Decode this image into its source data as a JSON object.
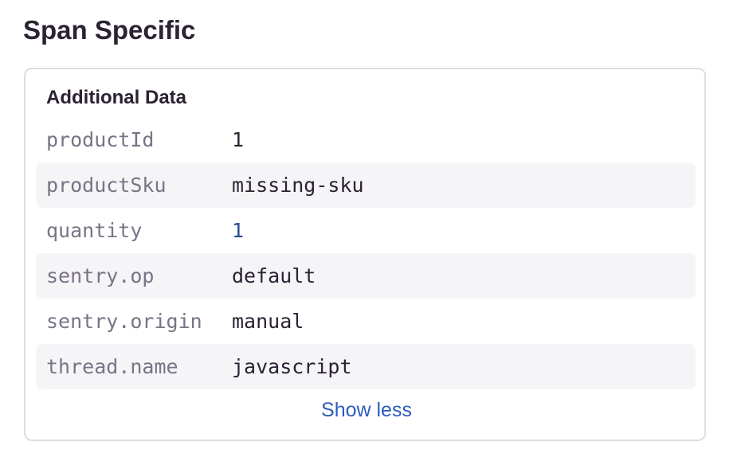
{
  "section": {
    "title": "Span Specific"
  },
  "card": {
    "title": "Additional Data",
    "rows": [
      {
        "key": "productId",
        "value": "1"
      },
      {
        "key": "productSku",
        "value": "missing-sku"
      },
      {
        "key": "quantity",
        "value": "1"
      },
      {
        "key": "sentry.op",
        "value": "default"
      },
      {
        "key": "sentry.origin",
        "value": "manual"
      },
      {
        "key": "thread.name",
        "value": "javascript"
      }
    ],
    "toggle_label": "Show less"
  },
  "colors": {
    "text": "#2b2233",
    "key_text": "#7a7385",
    "number_value": "#2b4d8f",
    "link": "#2f5bc0",
    "row_stripe": "#f5f4f7",
    "border": "#e0dce5"
  }
}
